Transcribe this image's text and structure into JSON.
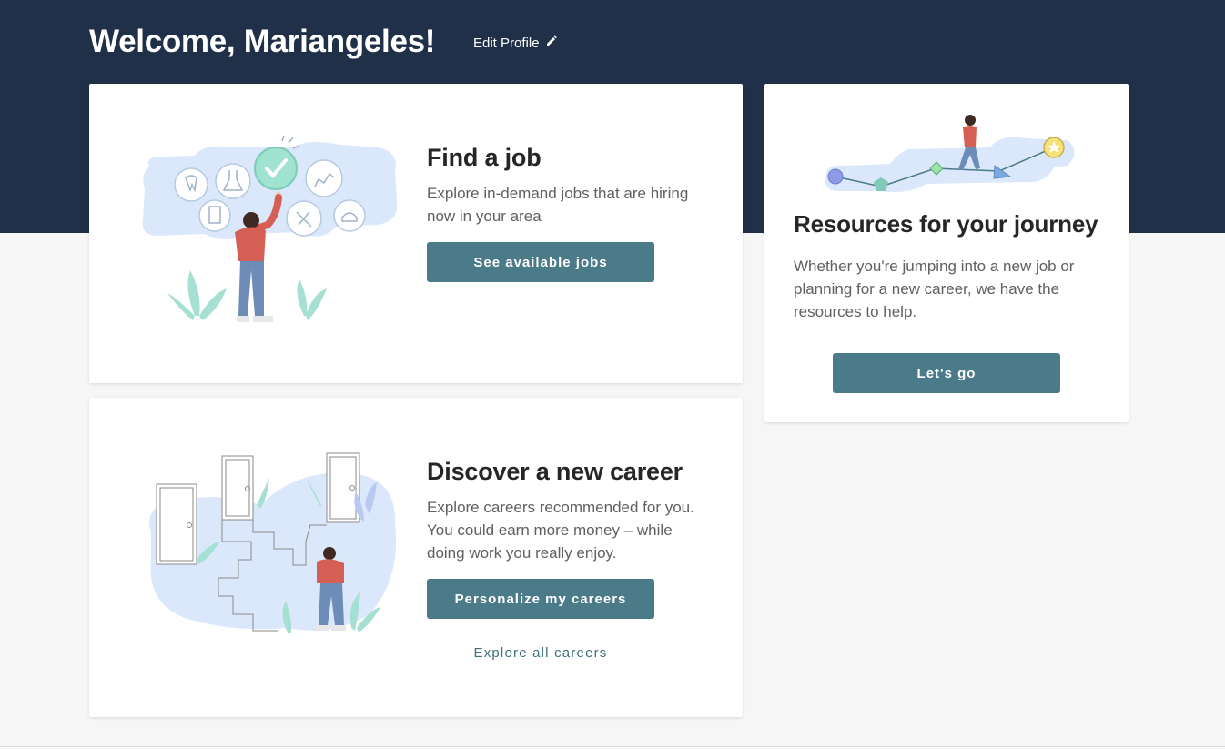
{
  "header": {
    "welcome": "Welcome, Mariangeles!",
    "edit_profile": "Edit Profile"
  },
  "cards": {
    "find_job": {
      "title": "Find a job",
      "description": "Explore in-demand jobs that are hiring now in your area",
      "button": "See available jobs"
    },
    "discover_career": {
      "title": "Discover a new career",
      "description": "Explore careers recommended for you. You could earn more money – while doing work you really enjoy.",
      "button": "Personalize my careers",
      "link": "Explore all careers"
    },
    "resources": {
      "title": "Resources for your journey",
      "description": "Whether you're jumping into a new job or planning for a new career, we have the resources to help.",
      "button": "Let's go"
    }
  },
  "colors": {
    "header_bg": "#1f3048",
    "button_bg": "#4b7a88",
    "page_bg": "#f6f6f6"
  }
}
